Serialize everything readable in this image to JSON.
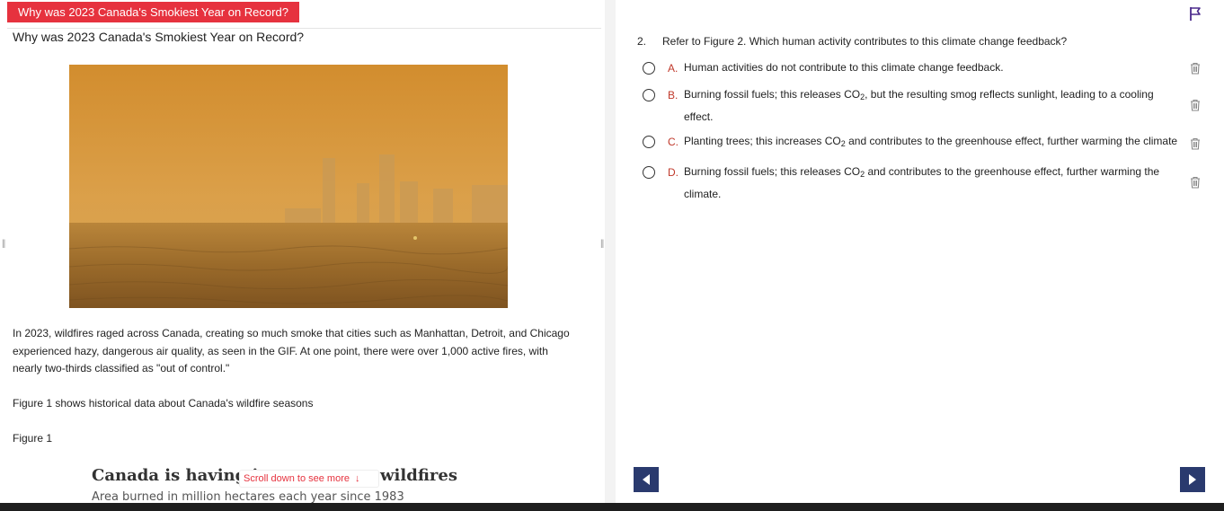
{
  "passage": {
    "tab_title": "Why was 2023 Canada's Smokiest Year on Record?",
    "heading": "Why was 2023 Canada's Smokiest Year on Record?",
    "paragraph_1": "In 2023, wildfires raged across Canada, creating so much smoke that cities such as Manhattan, Detroit, and Chicago experienced hazy, dangerous air quality, as seen in the GIF. At one point, there were over 1,000 active fires, with nearly two-thirds classified as \"out of control.\"",
    "paragraph_2": "Figure 1 shows historical data about Canada's wildfire seasons",
    "figure_label": "Figure 1",
    "embed_title": "Canada is having its worst year wildfires",
    "embed_subtitle": "Area burned in million hectares each year since 1983",
    "scroll_hint": "Scroll down to see more",
    "photo_icon": "smoky-skyline-photo"
  },
  "question": {
    "number": "2.",
    "text": "Refer to Figure 2. Which human activity contributes to this climate change feedback?",
    "choices": [
      {
        "letter": "A.",
        "text_before": "Human activities do not contribute to this climate change feedback.",
        "sub": "",
        "text_after": ""
      },
      {
        "letter": "B.",
        "text_before": "Burning fossil fuels; this releases CO",
        "sub": "2",
        "text_after": ", but the resulting smog reflects sunlight, leading to a cooling effect."
      },
      {
        "letter": "C.",
        "text_before": "Planting trees; this increases CO",
        "sub": "2",
        "text_after": " and contributes to the greenhouse effect, further warming the climate"
      },
      {
        "letter": "D.",
        "text_before": "Burning fossil fuels; this releases CO",
        "sub": "2",
        "text_after": " and contributes to the greenhouse effect, further warming the climate."
      }
    ]
  },
  "icons": {
    "flag": "flag-icon",
    "trash": "trash-icon",
    "prev": "triangle-left-icon",
    "next": "triangle-right-icon",
    "handle": "resize-handle-icon"
  },
  "colors": {
    "accent_red": "#e6323e",
    "nav_blue": "#2a3a6e",
    "flag_purple": "#4b2a8c",
    "choice_letter": "#c0392b"
  }
}
